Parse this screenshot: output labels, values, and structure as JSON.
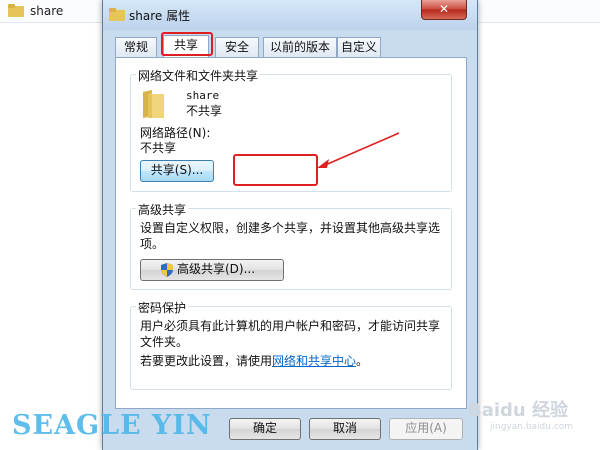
{
  "background": {
    "folder_label": "share"
  },
  "dialog": {
    "title": "share 属性",
    "close_label": "✕",
    "tabs": [
      {
        "label": "常规"
      },
      {
        "label": "共享"
      },
      {
        "label": "安全"
      },
      {
        "label": "以前的版本"
      },
      {
        "label": "自定义"
      }
    ],
    "network_share": {
      "group_label": "网络文件和文件夹共享",
      "folder_name": "share",
      "share_state": "不共享",
      "path_label": "网络路径(N):",
      "path_value": "不共享",
      "share_button": "共享(S)..."
    },
    "advanced_share": {
      "group_label": "高级共享",
      "description": "设置自定义权限，创建多个共享，并设置其他高级共享选项。",
      "button": "高级共享(D)..."
    },
    "password_protection": {
      "group_label": "密码保护",
      "description": "用户必须具有此计算机的用户帐户和密码，才能访问共享文件夹。",
      "change_prefix": "若要更改此设置，请使用",
      "change_link": "网络和共享中心",
      "change_suffix": "。"
    },
    "footer": {
      "ok": "确定",
      "cancel": "取消",
      "apply": "应用(A)"
    }
  },
  "watermark": {
    "left": "SEAGLE YIN",
    "right": "Baidu 经验",
    "sub": "jingyan.baidu.com"
  },
  "colors": {
    "dialog_frame": "#c9dcef",
    "highlight": "#e02020",
    "link": "#0066cc"
  }
}
